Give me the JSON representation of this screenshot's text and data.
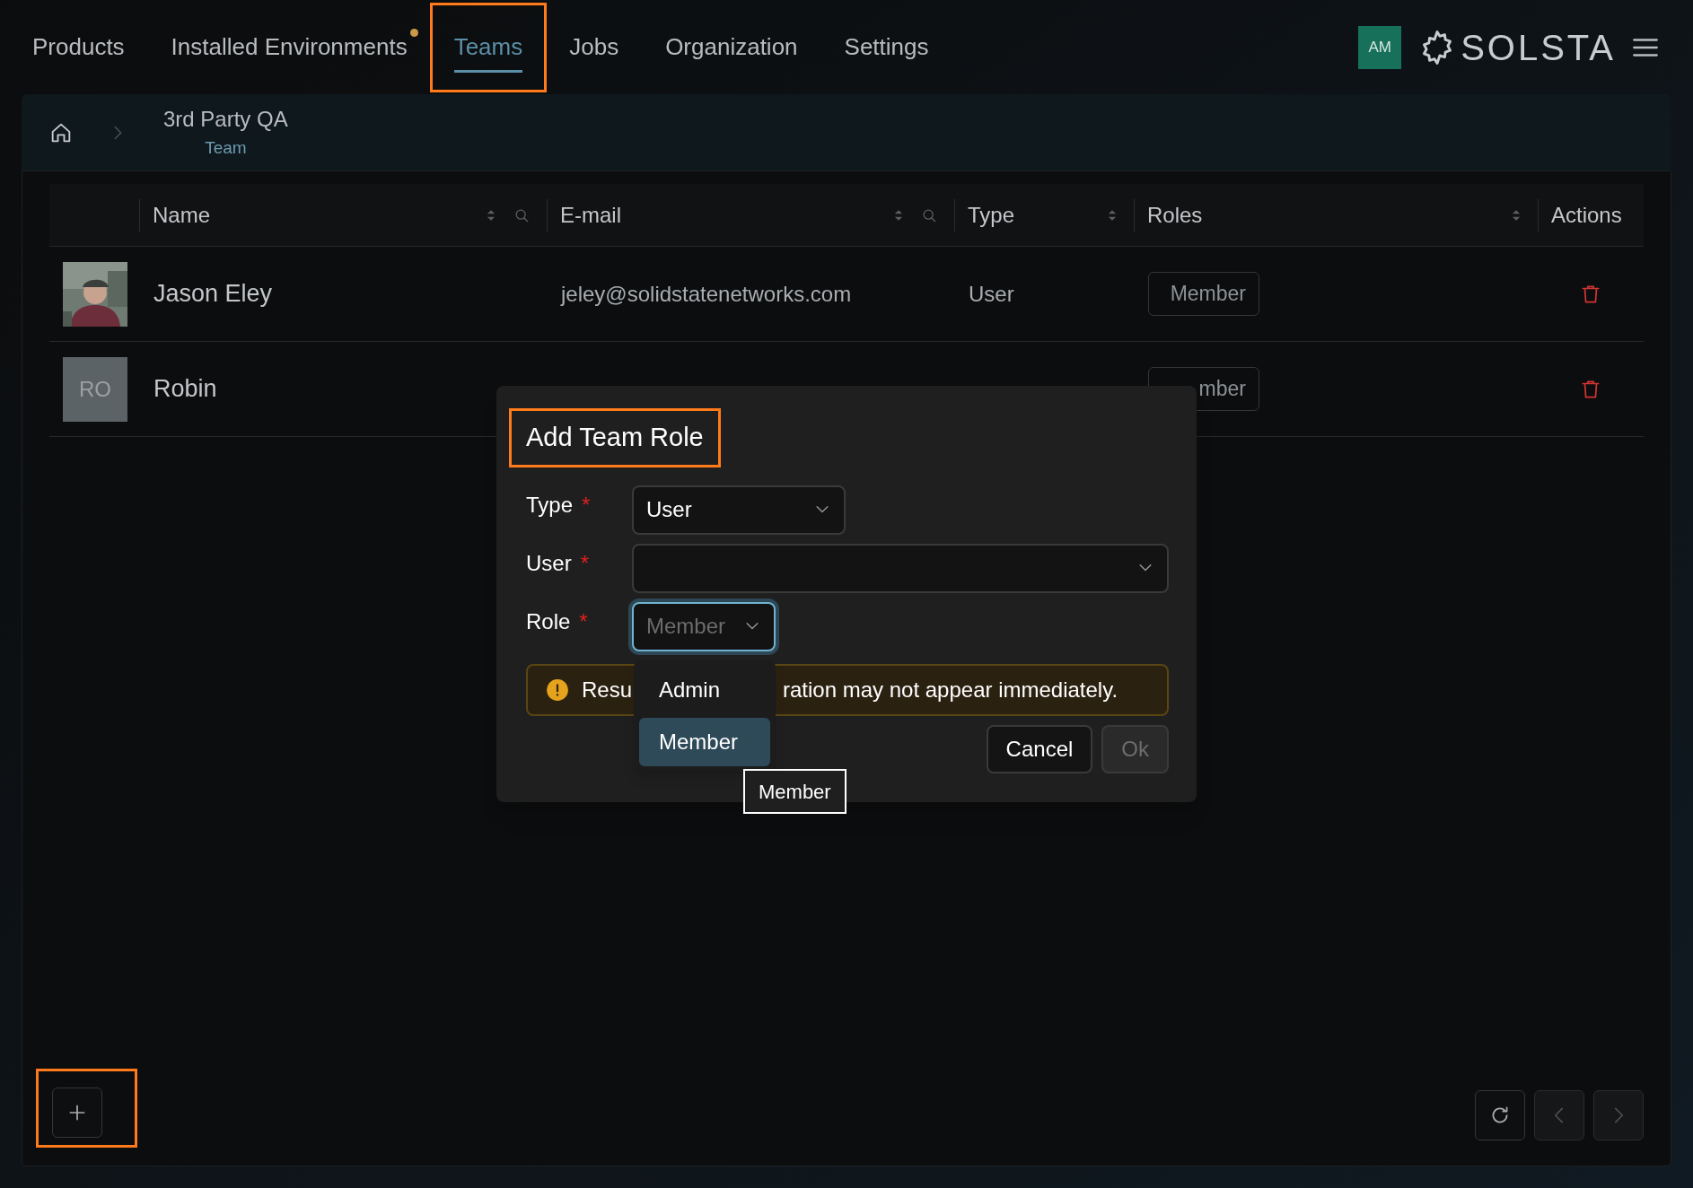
{
  "nav": {
    "tabs": [
      {
        "label": "Products",
        "selected": false,
        "dot": false,
        "highlighted": false
      },
      {
        "label": "Installed Environments",
        "selected": false,
        "dot": true,
        "highlighted": false
      },
      {
        "label": "Teams",
        "selected": true,
        "dot": false,
        "highlighted": true
      },
      {
        "label": "Jobs",
        "selected": false,
        "dot": false,
        "highlighted": false
      },
      {
        "label": "Organization",
        "selected": false,
        "dot": false,
        "highlighted": false
      },
      {
        "label": "Settings",
        "selected": false,
        "dot": false,
        "highlighted": false
      }
    ],
    "avatar": "AM",
    "logo": "SOLSTA"
  },
  "breadcrumb": {
    "title": "3rd Party QA",
    "subtitle": "Team"
  },
  "table": {
    "columns": [
      {
        "label": "Name",
        "sortable": true,
        "searchable": true
      },
      {
        "label": "E-mail",
        "sortable": true,
        "searchable": true
      },
      {
        "label": "Type",
        "sortable": true,
        "searchable": false
      },
      {
        "label": "Roles",
        "sortable": true,
        "searchable": false
      },
      {
        "label": "Actions",
        "sortable": false,
        "searchable": false
      }
    ],
    "rows": [
      {
        "name": "Jason Eley",
        "email": "jeley@solidstatenetworks.com",
        "type": "User",
        "role": "Member"
      },
      {
        "avatar": {
          "kind": "initials",
          "text": "RO"
        },
        "name": "Robin",
        "role": "mber"
      }
    ]
  },
  "dialog": {
    "title": "Add Team Role",
    "title_highlighted": true,
    "fields": [
      {
        "label": "Type",
        "required_mark": "*",
        "value": "User",
        "focused": false
      },
      {
        "label": "User",
        "required_mark": "*",
        "focused": false
      },
      {
        "label": "Role",
        "required_mark": "*",
        "value": "Member",
        "focused": true
      }
    ],
    "alert": [
      "Resu",
      "ration may not appear immediately."
    ],
    "buttons": [
      {
        "label": "Cancel",
        "disabled": false
      },
      {
        "label": "Ok",
        "disabled": true
      }
    ],
    "dropdown": [
      {
        "label": "Admin",
        "selected": false
      },
      {
        "label": "Member",
        "selected": true
      }
    ],
    "tooltip": "Member"
  },
  "footer": {
    "buttons": [
      {
        "kind": "add",
        "disabled": false,
        "highlighted": true
      },
      {
        "kind": "refresh",
        "disabled": false,
        "highlighted": false
      },
      {
        "kind": "previous",
        "disabled": true,
        "highlighted": false
      },
      {
        "kind": "next",
        "disabled": true,
        "highlighted": false
      }
    ]
  }
}
